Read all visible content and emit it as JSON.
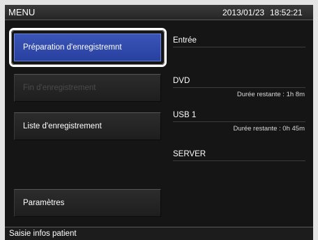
{
  "header": {
    "title": "MENU",
    "date": "2013/01/23",
    "time": "18:52:21"
  },
  "menu": {
    "items": [
      {
        "label": "Préparation d'enregistremnt",
        "state": "selected"
      },
      {
        "label": "Fin d'enregistrement",
        "state": "disabled"
      },
      {
        "label": "Liste d'enregistrement",
        "state": "normal"
      },
      {
        "label": "Paramètres",
        "state": "normal"
      }
    ]
  },
  "info": {
    "input_label": "Entrée",
    "dvd": {
      "label": "DVD",
      "remaining": "Durée restante : 1h 8m"
    },
    "usb": {
      "label": "USB 1",
      "remaining": "Durée restante : 0h 45m"
    },
    "server": {
      "label": "SERVER"
    }
  },
  "status": {
    "text": "Saisie infos patient"
  },
  "colors": {
    "selected_button": "#3a55b8",
    "background": "#151515"
  }
}
